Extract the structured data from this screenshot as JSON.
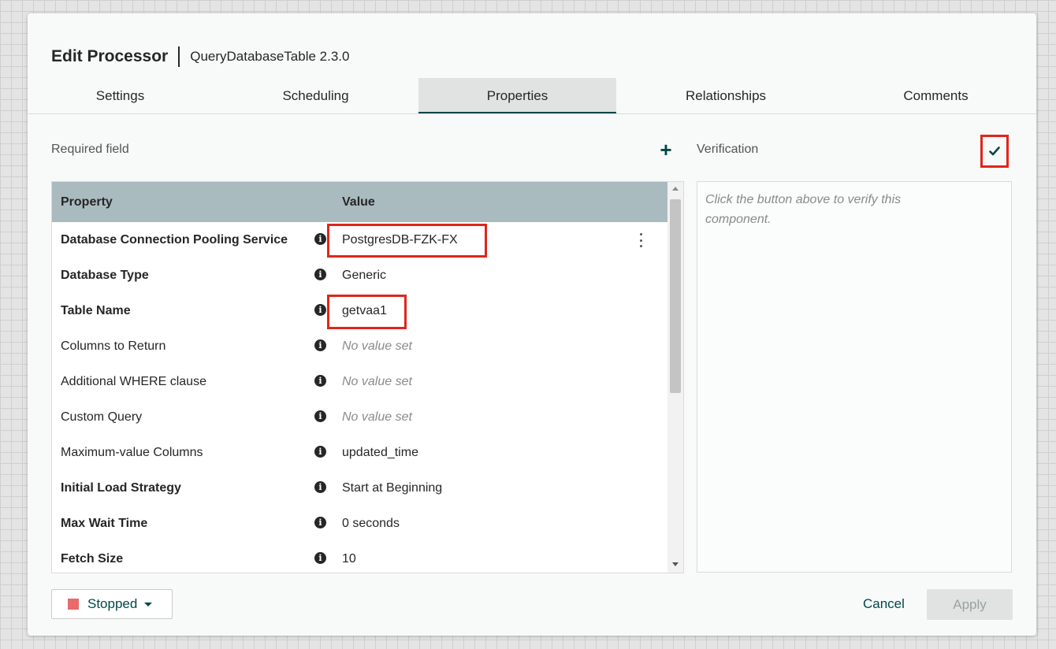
{
  "dialog": {
    "title": "Edit Processor",
    "subtitle": "QueryDatabaseTable 2.3.0"
  },
  "tabs": [
    {
      "label": "Settings"
    },
    {
      "label": "Scheduling"
    },
    {
      "label": "Properties",
      "active": true
    },
    {
      "label": "Relationships"
    },
    {
      "label": "Comments"
    }
  ],
  "properties": {
    "required_label": "Required field",
    "add_icon": "plus-icon",
    "table_headers": {
      "property": "Property",
      "value": "Value"
    },
    "rows": [
      {
        "name": "Database Connection Pooling Service",
        "value": "PostgresDB-FZK-FX",
        "required": true,
        "empty": false
      },
      {
        "name": "Database Type",
        "value": "Generic",
        "required": true,
        "empty": false
      },
      {
        "name": "Table Name",
        "value": "getvaa1",
        "required": true,
        "empty": false
      },
      {
        "name": "Columns to Return",
        "value": "No value set",
        "required": false,
        "empty": true
      },
      {
        "name": "Additional WHERE clause",
        "value": "No value set",
        "required": false,
        "empty": true
      },
      {
        "name": "Custom Query",
        "value": "No value set",
        "required": false,
        "empty": true
      },
      {
        "name": "Maximum-value Columns",
        "value": "updated_time",
        "required": false,
        "empty": false
      },
      {
        "name": "Initial Load Strategy",
        "value": "Start at Beginning",
        "required": true,
        "empty": false
      },
      {
        "name": "Max Wait Time",
        "value": "0 seconds",
        "required": true,
        "empty": false
      },
      {
        "name": "Fetch Size",
        "value": "10",
        "required": true,
        "empty": false
      }
    ]
  },
  "verification": {
    "label": "Verification",
    "hint": "Click the button above to verify this component.",
    "verify_icon": "checkmark-icon"
  },
  "footer": {
    "state_label": "Stopped",
    "cancel_label": "Cancel",
    "apply_label": "Apply"
  },
  "colors": {
    "accent": "#004849",
    "highlight": "#e0251b",
    "header_bg": "#aabbc0",
    "stopped": "#e86a6a"
  }
}
